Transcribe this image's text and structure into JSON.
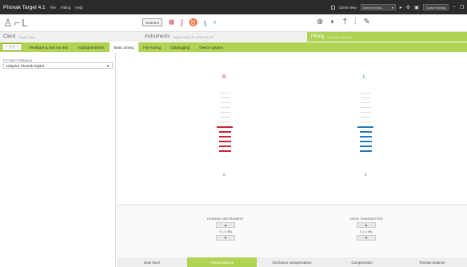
{
  "titlebar": {
    "app_title": "Phonak Target 4.1",
    "menus": [
      "File",
      "Fitting",
      "Help"
    ],
    "client_view_label": "Client view",
    "select_media_placeholder": "Select media...",
    "close_training_label": "Close training"
  },
  "toolbar": {
    "connect_label": "Connect"
  },
  "headers": {
    "client": "Client",
    "client_sub": "Trader Tom",
    "instruments": "Instruments",
    "instruments_sub": "Audéo V90-13 / CROS II-13",
    "fitting": "Fitting",
    "fitting_sub": "SB Calm situation"
  },
  "tabs": {
    "items": [
      "Feedback & real ear test",
      "AudiogramDirect",
      "Basic tuning",
      "Fine tuning",
      "Datalogging",
      "Device options"
    ],
    "active": "Basic tuning"
  },
  "left_panel": {
    "fitting_formula_label": "FITTING FORMULA",
    "fitting_formula_value": "Adaptive Phonak Digital"
  },
  "tuning": {
    "right": {
      "side_label": "R",
      "active_level": 6,
      "max_level": 13,
      "value": "0",
      "color": "#cc2233"
    },
    "left": {
      "side_label": "L",
      "active_level": 6,
      "max_level": 13,
      "value": "0",
      "color": "#1f7ab8"
    }
  },
  "controls": {
    "hearing_instrument": {
      "title": "HEARING INSTRUMENT",
      "value": "0 (-1 dB)"
    },
    "cros_transmitter": {
      "title": "CROS TRANSMITTER",
      "value": "0 (-1 dB)"
    }
  },
  "bottom_tabs": {
    "items": [
      "Gain level",
      "CROS balance",
      "Occlusion compensation",
      "Compression",
      "Tinnitus balance"
    ],
    "active": "CROS balance"
  }
}
